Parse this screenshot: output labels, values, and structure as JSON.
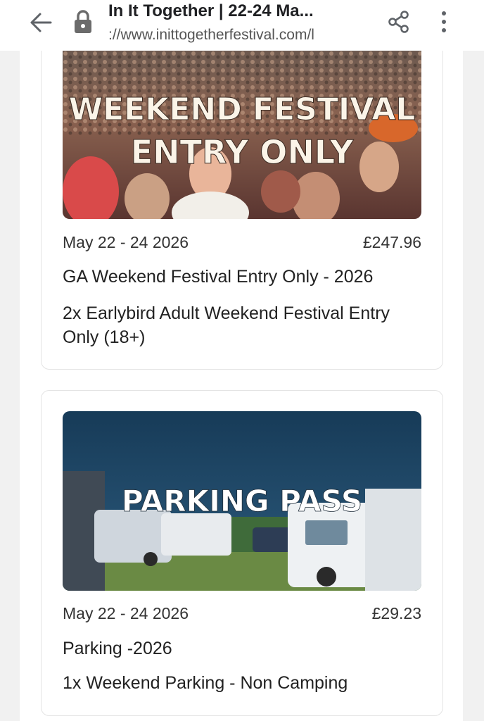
{
  "browser": {
    "title": "In It Together | 22-24 Ma...",
    "url": "://www.inittogetherfestival.com/l"
  },
  "colors": {
    "accent_text": "#222222",
    "banner_text": "#ffffff"
  },
  "tickets": [
    {
      "banner_text_line1": "WEEKEND FESTIVAL",
      "banner_text_line2": "ENTRY ONLY",
      "date": "May 22 - 24 2026",
      "price": "£247.96",
      "title": "GA Weekend Festival Entry Only - 2026",
      "description": "2x Earlybird Adult Weekend Festival Entry Only (18+)"
    },
    {
      "banner_text_line1": "PARKING PASS",
      "date": "May 22 - 24 2026",
      "price": "£29.23",
      "title": "Parking -2026",
      "description": "1x Weekend Parking - Non Camping"
    }
  ]
}
